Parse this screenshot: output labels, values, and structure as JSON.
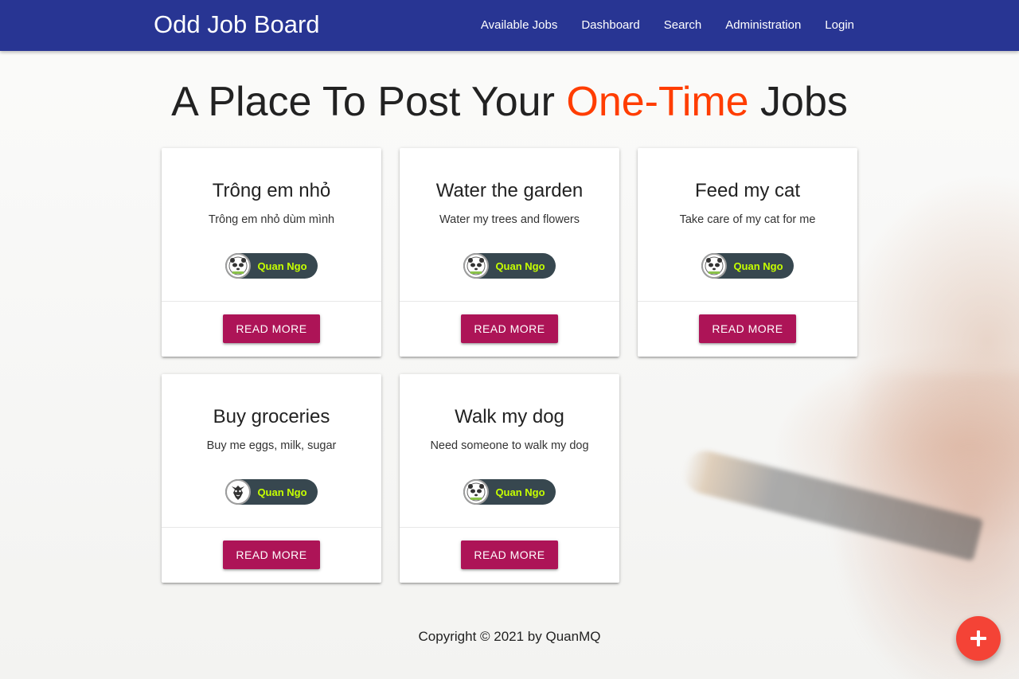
{
  "app": {
    "brand": "Odd Job Board"
  },
  "nav": {
    "items": [
      {
        "label": "Available Jobs"
      },
      {
        "label": "Dashboard"
      },
      {
        "label": "Search"
      },
      {
        "label": "Administration"
      },
      {
        "label": "Login"
      }
    ]
  },
  "hero": {
    "prefix": "A Place To Post Your ",
    "accent": "One-Time",
    "suffix": " Jobs"
  },
  "jobs": [
    {
      "title": "Trông em nhỏ",
      "description": "Trông em nhỏ dùm mình",
      "owner": "Quan Ngo",
      "avatar": "panda-avatar-icon",
      "action": "READ MORE"
    },
    {
      "title": "Water the garden",
      "description": "Water my trees and flowers",
      "owner": "Quan Ngo",
      "avatar": "panda-avatar-icon",
      "action": "READ MORE"
    },
    {
      "title": "Feed my cat",
      "description": "Take care of my cat for me",
      "owner": "Quan Ngo",
      "avatar": "panda-avatar-icon",
      "action": "READ MORE"
    },
    {
      "title": "Buy groceries",
      "description": "Buy me eggs, milk, sugar",
      "owner": "Quan Ngo",
      "avatar": "dragon-avatar-icon",
      "action": "READ MORE"
    },
    {
      "title": "Walk my dog",
      "description": "Need someone to walk my dog",
      "owner": "Quan Ngo",
      "avatar": "panda-avatar-icon",
      "action": "READ MORE"
    }
  ],
  "footer": {
    "text": "Copyright © 2021 by QuanMQ"
  },
  "fab": {
    "icon": "plus-icon"
  },
  "colors": {
    "navbar": "#283593",
    "accent": "#ff3d00",
    "button": "#ad1457",
    "chip": "#37474f",
    "chip_text": "#c6ff00",
    "fab": "#f44336"
  }
}
